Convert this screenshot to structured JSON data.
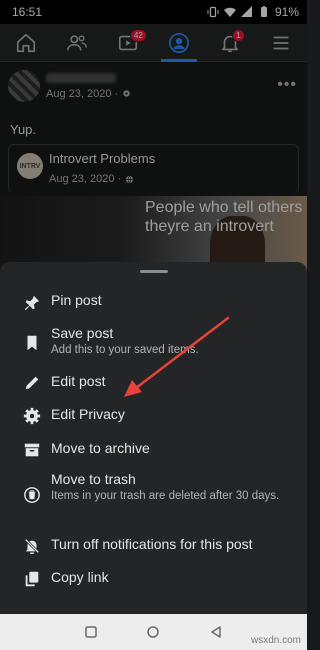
{
  "status": {
    "time": "16:51",
    "battery": "91%"
  },
  "nav": {
    "video_badge": "42",
    "notifications_badge": "1"
  },
  "post": {
    "date": "Aug 23, 2020 · ",
    "text": "Yup.",
    "shared": {
      "avatar_text": "INTRV",
      "name": "Introvert Problems",
      "date": "Aug 23, 2020 · "
    },
    "meme_text": "People who tell others theyre an introvert"
  },
  "menu": {
    "items": [
      {
        "label": "Pin post",
        "icon": "pin-icon"
      },
      {
        "label": "Save post",
        "desc": "Add this to your saved items.",
        "icon": "bookmark-icon"
      },
      {
        "label": "Edit post",
        "icon": "pencil-icon"
      },
      {
        "label": "Edit Privacy",
        "icon": "gear-icon"
      },
      {
        "label": "Move to archive",
        "icon": "archive-icon"
      },
      {
        "label": "Move to trash",
        "desc": "Items in your trash are deleted after 30 days.",
        "icon": "trash-icon"
      },
      {
        "label": "Turn off notifications for this post",
        "icon": "bell-off-icon"
      },
      {
        "label": "Copy link",
        "icon": "copy-icon"
      }
    ]
  },
  "colors": {
    "accent": "#2d88ff",
    "badge": "#e41e3f",
    "arrow": "#e8433a",
    "sheet": "#242526"
  },
  "watermark": "wsxdn.com"
}
